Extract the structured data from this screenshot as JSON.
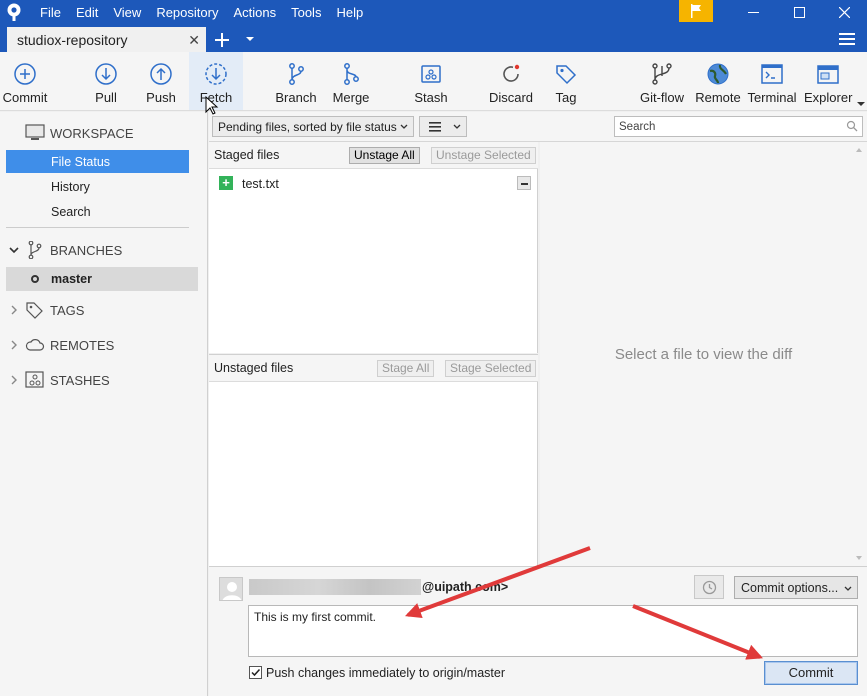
{
  "menu": [
    "File",
    "Edit",
    "View",
    "Repository",
    "Actions",
    "Tools",
    "Help"
  ],
  "tab": {
    "title": "studiox-repository"
  },
  "toolbar": {
    "commit": "Commit",
    "pull": "Pull",
    "push": "Push",
    "fetch": "Fetch",
    "branch": "Branch",
    "merge": "Merge",
    "stash": "Stash",
    "discard": "Discard",
    "tag": "Tag",
    "gitflow": "Git-flow",
    "remote": "Remote",
    "terminal": "Terminal",
    "explorer": "Explorer"
  },
  "sidebar": {
    "workspace": "WORKSPACE",
    "items": [
      "File Status",
      "History",
      "Search"
    ],
    "branches": "BRANCHES",
    "current_branch": "master",
    "tags": "TAGS",
    "remotes": "REMOTES",
    "stashes": "STASHES"
  },
  "filter": {
    "sort_label": "Pending files, sorted by file status",
    "search_placeholder": "Search"
  },
  "staged": {
    "title": "Staged files",
    "unstage_all": "Unstage All",
    "unstage_selected": "Unstage Selected",
    "files": [
      "test.txt"
    ]
  },
  "unstaged": {
    "title": "Unstaged files",
    "stage_all": "Stage All",
    "stage_selected": "Stage Selected"
  },
  "diff": {
    "empty_message": "Select a file to view the diff"
  },
  "commit": {
    "author_email": "@uipath.com>",
    "options_label": "Commit options...",
    "message": "This is my first commit.",
    "push_label": "Push changes immediately to origin/master",
    "push_checked": true,
    "button": "Commit"
  },
  "colors": {
    "titlebar": "#1d58ba",
    "selection": "#3f8ee9",
    "annotation_arrow": "#e03a3a",
    "flag": "#f6b400"
  }
}
